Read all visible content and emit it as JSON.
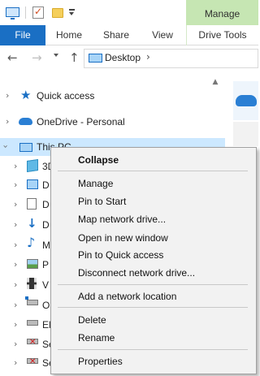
{
  "ribbon": {
    "context_group_label": "Manage",
    "tabs": [
      {
        "label": "File"
      },
      {
        "label": "Home"
      },
      {
        "label": "Share"
      },
      {
        "label": "View"
      },
      {
        "label": "Drive Tools"
      }
    ]
  },
  "addressbar": {
    "location": "Desktop"
  },
  "navpane": {
    "items": [
      {
        "label": "Quick access",
        "icon": "star-icon"
      },
      {
        "label": "OneDrive - Personal",
        "icon": "cloud-icon"
      },
      {
        "label": "This PC",
        "icon": "computer-icon",
        "selected": true
      }
    ],
    "children": [
      {
        "label": "3D",
        "icon": "3d-objects-icon"
      },
      {
        "label": "D",
        "icon": "desktop-icon"
      },
      {
        "label": "D",
        "icon": "documents-icon"
      },
      {
        "label": "D",
        "icon": "downloads-icon"
      },
      {
        "label": "M",
        "icon": "music-icon"
      },
      {
        "label": "P",
        "icon": "pictures-icon"
      },
      {
        "label": "V",
        "icon": "videos-icon"
      },
      {
        "label": "O",
        "icon": "os-drive-icon"
      },
      {
        "label": "El",
        "icon": "drive-icon"
      },
      {
        "label": "Se",
        "icon": "disconnected-drive-icon"
      },
      {
        "label": "Se",
        "icon": "disconnected-drive-icon"
      }
    ]
  },
  "context_menu": {
    "collapse": "Collapse",
    "manage": "Manage",
    "pin_to_start": "Pin to Start",
    "map_network_drive": "Map network drive...",
    "open_new_window": "Open in new window",
    "pin_quick_access": "Pin to Quick access",
    "disconnect_drive": "Disconnect network drive...",
    "add_network_location": "Add a network location",
    "delete": "Delete",
    "rename": "Rename",
    "properties": "Properties"
  },
  "colors": {
    "accent": "#1a6fc4",
    "context_tab": "#c6e6b3",
    "selection": "#cce8ff",
    "menu_background": "#f2f2f2"
  }
}
